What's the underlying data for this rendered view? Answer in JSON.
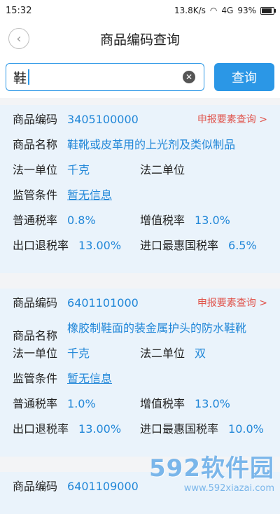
{
  "status": {
    "time": "15:32",
    "speed": "13.8K/s",
    "network": "4G",
    "battery": "93%"
  },
  "nav": {
    "title": "商品编码查询"
  },
  "search": {
    "value": "鞋",
    "button": "查询"
  },
  "labels": {
    "code": "商品编码",
    "name": "商品名称",
    "unit1": "法一单位",
    "unit2": "法二单位",
    "supervision": "监管条件",
    "general_rate": "普通税率",
    "vat_rate": "增值税率",
    "export_rebate": "出口退税率",
    "mfn_rate": "进口最惠国税率",
    "declare": "申报要素查询 >"
  },
  "items": [
    {
      "code": "3405100000",
      "name": "鞋靴或皮革用的上光剂及类似制品",
      "unit1": "千克",
      "unit2": "",
      "supervision": "暂无信息",
      "general_rate": "0.8%",
      "vat_rate": "13.0%",
      "export_rebate": "13.00%",
      "mfn_rate": "6.5%"
    },
    {
      "code": "6401101000",
      "name": "橡胶制鞋面的装金属护头的防水鞋靴",
      "unit1": "千克",
      "unit2": "双",
      "supervision": "暂无信息",
      "general_rate": "1.0%",
      "vat_rate": "13.0%",
      "export_rebate": "13.00%",
      "mfn_rate": "10.0%"
    },
    {
      "code": "6401109000"
    }
  ],
  "watermark": {
    "logo": "592软件园",
    "url": "www.592xiazai.com"
  }
}
